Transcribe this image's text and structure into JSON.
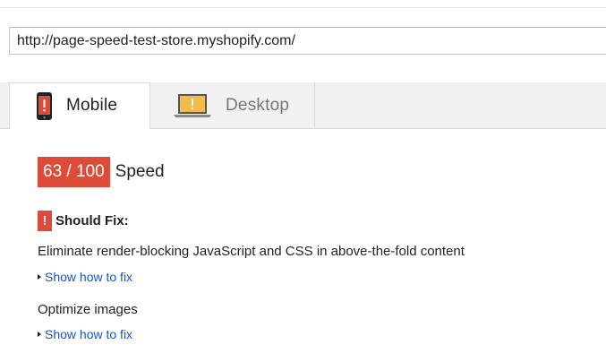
{
  "url_input": {
    "value": "http://page-speed-test-store.myshopify.com/"
  },
  "tabs": [
    {
      "label": "Mobile",
      "icon": "mobile-phone-icon",
      "active": true
    },
    {
      "label": "Desktop",
      "icon": "laptop-icon",
      "active": false
    }
  ],
  "score": {
    "value": "63 / 100",
    "label": "Speed"
  },
  "section": {
    "icon_glyph": "!",
    "title": "Should Fix:"
  },
  "rules": [
    {
      "title": "Eliminate render-blocking JavaScript and CSS in above-the-fold content",
      "link": "Show how to fix"
    },
    {
      "title": "Optimize images",
      "link": "Show how to fix"
    }
  ],
  "colors": {
    "warning_red": "#dd4b39",
    "link_blue": "#1155cc",
    "laptop_screen_yellow": "#f6b94c"
  }
}
